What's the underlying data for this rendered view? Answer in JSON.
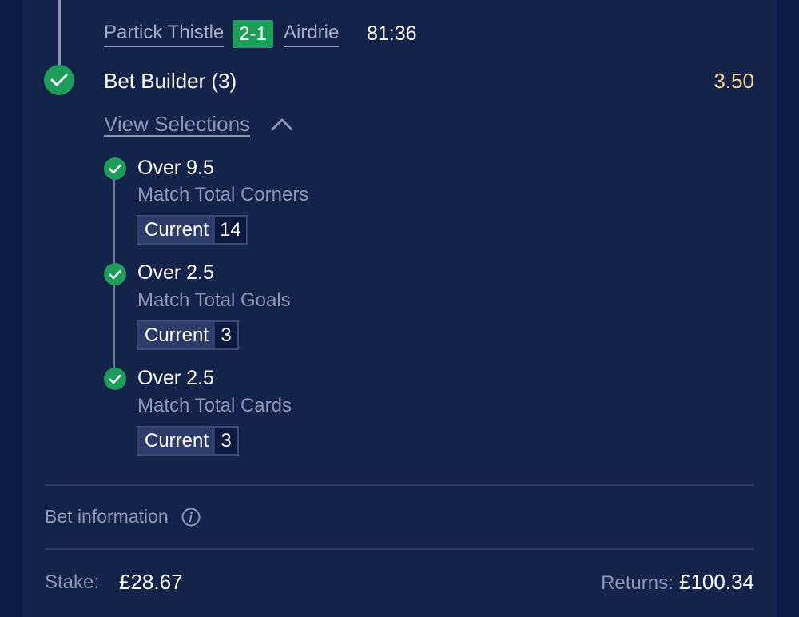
{
  "match": {
    "home_team": "Partick Thistle",
    "score": "2-1",
    "away_team": "Airdrie",
    "clock": "81:36"
  },
  "bet": {
    "title": "Bet Builder (3)",
    "odds": "3.50",
    "view_selections_label": "View Selections"
  },
  "selections": [
    {
      "title": "Over 9.5",
      "market": "Match Total Corners",
      "current_label": "Current",
      "current_value": "14"
    },
    {
      "title": "Over 2.5",
      "market": "Match Total Goals",
      "current_label": "Current",
      "current_value": "3"
    },
    {
      "title": "Over 2.5",
      "market": "Match Total Cards",
      "current_label": "Current",
      "current_value": "3"
    }
  ],
  "footer": {
    "bet_information_label": "Bet information",
    "stake_label": "Stake:",
    "stake_value": "£28.67",
    "returns_label": "Returns:",
    "returns_value": "£100.34"
  },
  "icons": {
    "check": "check-icon",
    "chevron": "chevron-up-icon",
    "info": "info-icon"
  },
  "colors": {
    "background": "#0a1b46",
    "card": "#14234a",
    "success": "#1e9c5a",
    "odds": "#f0d28e",
    "muted": "#8d97b4"
  }
}
